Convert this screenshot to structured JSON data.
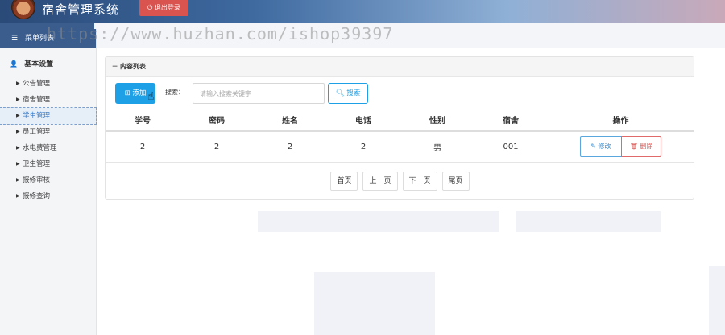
{
  "header": {
    "title": "宿舍管理系统",
    "logout_label": "退出登录"
  },
  "watermark": "https://www.huzhan.com/ishop39397",
  "sidebar": {
    "menu_title": "菜单列表",
    "section_title": "基本设置",
    "items": [
      {
        "label": "公告管理",
        "active": false
      },
      {
        "label": "宿舍管理",
        "active": false
      },
      {
        "label": "学生管理",
        "active": true
      },
      {
        "label": "员工管理",
        "active": false
      },
      {
        "label": "水电费管理",
        "active": false
      },
      {
        "label": "卫生管理",
        "active": false
      },
      {
        "label": "报修审核",
        "active": false
      },
      {
        "label": "报修查询",
        "active": false
      }
    ]
  },
  "panel": {
    "title": "内容列表",
    "add_label": "添加",
    "search_label": "搜索：",
    "search_placeholder": "请输入搜索关键字",
    "search_button": "搜索",
    "columns": [
      "学号",
      "密码",
      "姓名",
      "电话",
      "性别",
      "宿舍",
      "操作"
    ],
    "rows": [
      {
        "id": "2",
        "password": "2",
        "name": "2",
        "phone": "2",
        "gender": "男",
        "dorm": "001"
      }
    ],
    "edit_label": "修改",
    "delete_label": "删除",
    "pager": [
      "首页",
      "上一页",
      "下一页",
      "尾页"
    ]
  },
  "colors": {
    "accent": "#1ea0e6",
    "danger": "#d9534f",
    "sidebar_header": "#3a5d8e"
  }
}
